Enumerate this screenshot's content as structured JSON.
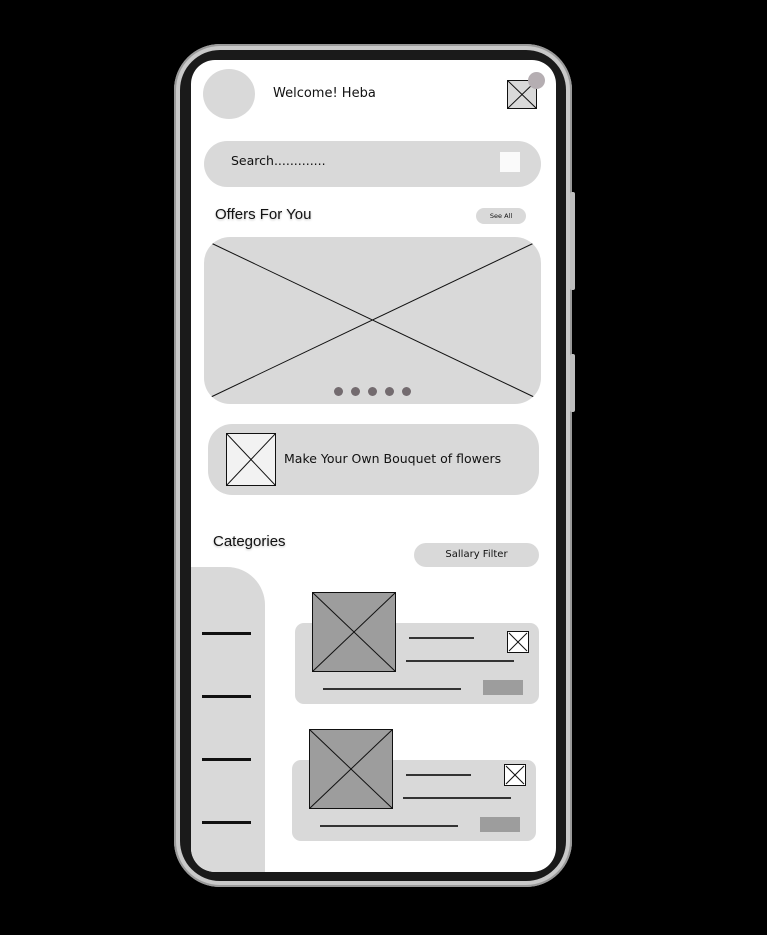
{
  "header": {
    "welcome_text": "Welcome! Heba",
    "avatar_icon": "avatar-placeholder",
    "notification_icon": "image-placeholder-icon"
  },
  "search": {
    "placeholder_text": "Search............."
  },
  "offers": {
    "title": "Offers For You",
    "see_all_label": "See All",
    "carousel_pages": 5
  },
  "bouquet_card": {
    "label": "Make Your Own Bouquet of flowers"
  },
  "categories": {
    "title": "Categories",
    "filter_label": "Sallary Filter",
    "side_menu_items": 4,
    "product_cards": 2
  },
  "colors": {
    "placeholder_fill": "#d9d9d9",
    "image_fill": "#9d9d9d",
    "dot_color": "#736b6f",
    "background": "#000000"
  }
}
